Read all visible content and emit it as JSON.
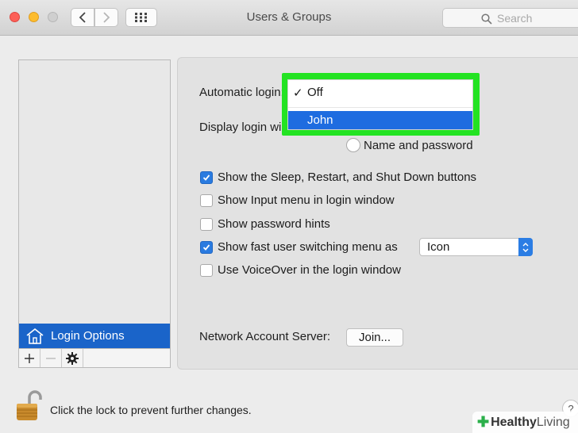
{
  "window": {
    "title": "Users & Groups"
  },
  "search": {
    "placeholder": "Search"
  },
  "sidebar": {
    "selected_item": "Login Options"
  },
  "settings": {
    "automatic_login_label": "Automatic login:",
    "display_login_label": "Display login window as:",
    "name_and_password_label": "Name and password",
    "checkboxes": [
      {
        "label": "Show the Sleep, Restart, and Shut Down buttons",
        "checked": true
      },
      {
        "label": "Show Input menu in login window",
        "checked": false
      },
      {
        "label": "Show password hints",
        "checked": false
      },
      {
        "label": "Show fast user switching menu as",
        "checked": true
      },
      {
        "label": "Use VoiceOver in the login window",
        "checked": false
      }
    ],
    "fast_switch_value": "Icon",
    "network_server_label": "Network Account Server:",
    "join_button": "Join..."
  },
  "dropdown": {
    "items": [
      {
        "label": "Off",
        "selected": true
      },
      {
        "label": "John",
        "highlighted": true
      }
    ],
    "checkmark": "✓"
  },
  "footer": {
    "lock_text": "Click the lock to prevent further changes.",
    "help": "?"
  },
  "watermark": {
    "brand_a": "Healthy",
    "brand_b": "Living"
  },
  "colors": {
    "accent": "#1e6ce0",
    "highlight_box": "#23e322",
    "sidebar_selection": "#1a64c9"
  }
}
